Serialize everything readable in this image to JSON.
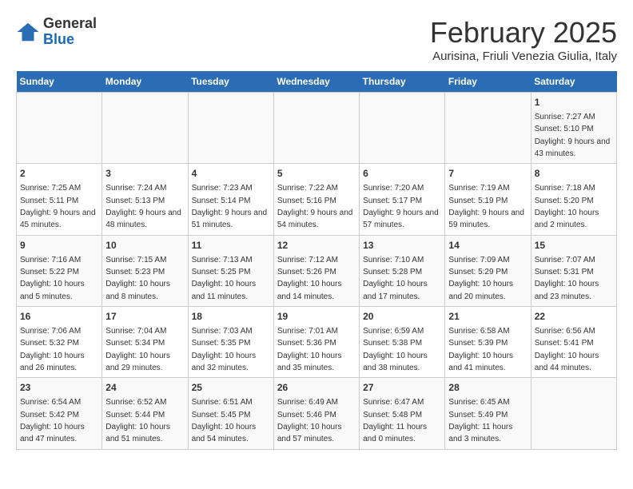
{
  "logo": {
    "general": "General",
    "blue": "Blue"
  },
  "header": {
    "title": "February 2025",
    "subtitle": "Aurisina, Friuli Venezia Giulia, Italy"
  },
  "weekdays": [
    "Sunday",
    "Monday",
    "Tuesday",
    "Wednesday",
    "Thursday",
    "Friday",
    "Saturday"
  ],
  "weeks": [
    [
      {
        "day": "",
        "detail": ""
      },
      {
        "day": "",
        "detail": ""
      },
      {
        "day": "",
        "detail": ""
      },
      {
        "day": "",
        "detail": ""
      },
      {
        "day": "",
        "detail": ""
      },
      {
        "day": "",
        "detail": ""
      },
      {
        "day": "1",
        "detail": "Sunrise: 7:27 AM\nSunset: 5:10 PM\nDaylight: 9 hours and 43 minutes."
      }
    ],
    [
      {
        "day": "2",
        "detail": "Sunrise: 7:25 AM\nSunset: 5:11 PM\nDaylight: 9 hours and 45 minutes."
      },
      {
        "day": "3",
        "detail": "Sunrise: 7:24 AM\nSunset: 5:13 PM\nDaylight: 9 hours and 48 minutes."
      },
      {
        "day": "4",
        "detail": "Sunrise: 7:23 AM\nSunset: 5:14 PM\nDaylight: 9 hours and 51 minutes."
      },
      {
        "day": "5",
        "detail": "Sunrise: 7:22 AM\nSunset: 5:16 PM\nDaylight: 9 hours and 54 minutes."
      },
      {
        "day": "6",
        "detail": "Sunrise: 7:20 AM\nSunset: 5:17 PM\nDaylight: 9 hours and 57 minutes."
      },
      {
        "day": "7",
        "detail": "Sunrise: 7:19 AM\nSunset: 5:19 PM\nDaylight: 9 hours and 59 minutes."
      },
      {
        "day": "8",
        "detail": "Sunrise: 7:18 AM\nSunset: 5:20 PM\nDaylight: 10 hours and 2 minutes."
      }
    ],
    [
      {
        "day": "9",
        "detail": "Sunrise: 7:16 AM\nSunset: 5:22 PM\nDaylight: 10 hours and 5 minutes."
      },
      {
        "day": "10",
        "detail": "Sunrise: 7:15 AM\nSunset: 5:23 PM\nDaylight: 10 hours and 8 minutes."
      },
      {
        "day": "11",
        "detail": "Sunrise: 7:13 AM\nSunset: 5:25 PM\nDaylight: 10 hours and 11 minutes."
      },
      {
        "day": "12",
        "detail": "Sunrise: 7:12 AM\nSunset: 5:26 PM\nDaylight: 10 hours and 14 minutes."
      },
      {
        "day": "13",
        "detail": "Sunrise: 7:10 AM\nSunset: 5:28 PM\nDaylight: 10 hours and 17 minutes."
      },
      {
        "day": "14",
        "detail": "Sunrise: 7:09 AM\nSunset: 5:29 PM\nDaylight: 10 hours and 20 minutes."
      },
      {
        "day": "15",
        "detail": "Sunrise: 7:07 AM\nSunset: 5:31 PM\nDaylight: 10 hours and 23 minutes."
      }
    ],
    [
      {
        "day": "16",
        "detail": "Sunrise: 7:06 AM\nSunset: 5:32 PM\nDaylight: 10 hours and 26 minutes."
      },
      {
        "day": "17",
        "detail": "Sunrise: 7:04 AM\nSunset: 5:34 PM\nDaylight: 10 hours and 29 minutes."
      },
      {
        "day": "18",
        "detail": "Sunrise: 7:03 AM\nSunset: 5:35 PM\nDaylight: 10 hours and 32 minutes."
      },
      {
        "day": "19",
        "detail": "Sunrise: 7:01 AM\nSunset: 5:36 PM\nDaylight: 10 hours and 35 minutes."
      },
      {
        "day": "20",
        "detail": "Sunrise: 6:59 AM\nSunset: 5:38 PM\nDaylight: 10 hours and 38 minutes."
      },
      {
        "day": "21",
        "detail": "Sunrise: 6:58 AM\nSunset: 5:39 PM\nDaylight: 10 hours and 41 minutes."
      },
      {
        "day": "22",
        "detail": "Sunrise: 6:56 AM\nSunset: 5:41 PM\nDaylight: 10 hours and 44 minutes."
      }
    ],
    [
      {
        "day": "23",
        "detail": "Sunrise: 6:54 AM\nSunset: 5:42 PM\nDaylight: 10 hours and 47 minutes."
      },
      {
        "day": "24",
        "detail": "Sunrise: 6:52 AM\nSunset: 5:44 PM\nDaylight: 10 hours and 51 minutes."
      },
      {
        "day": "25",
        "detail": "Sunrise: 6:51 AM\nSunset: 5:45 PM\nDaylight: 10 hours and 54 minutes."
      },
      {
        "day": "26",
        "detail": "Sunrise: 6:49 AM\nSunset: 5:46 PM\nDaylight: 10 hours and 57 minutes."
      },
      {
        "day": "27",
        "detail": "Sunrise: 6:47 AM\nSunset: 5:48 PM\nDaylight: 11 hours and 0 minutes."
      },
      {
        "day": "28",
        "detail": "Sunrise: 6:45 AM\nSunset: 5:49 PM\nDaylight: 11 hours and 3 minutes."
      },
      {
        "day": "",
        "detail": ""
      }
    ]
  ]
}
